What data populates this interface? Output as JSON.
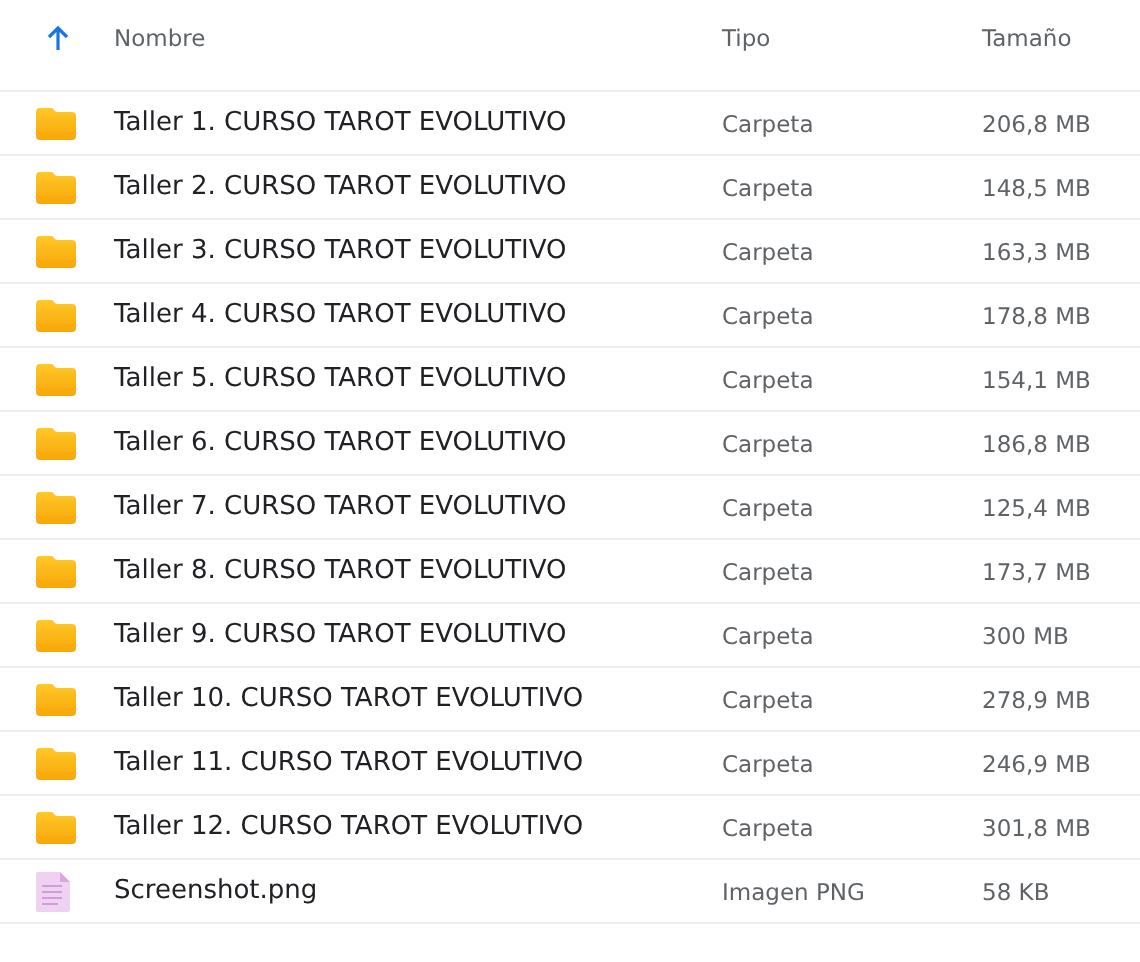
{
  "table": {
    "columns": [
      {
        "label": "Nombre",
        "sorted": true
      },
      {
        "label": "Tipo"
      },
      {
        "label": "Tamaño"
      }
    ],
    "rows": [
      {
        "kind": "folder",
        "name": "Taller 1. CURSO TAROT EVOLUTIVO",
        "type": "Carpeta",
        "size": "206,8 MB"
      },
      {
        "kind": "folder",
        "name": "Taller 2. CURSO TAROT EVOLUTIVO",
        "type": "Carpeta",
        "size": "148,5 MB"
      },
      {
        "kind": "folder",
        "name": "Taller 3. CURSO TAROT EVOLUTIVO",
        "type": "Carpeta",
        "size": "163,3 MB"
      },
      {
        "kind": "folder",
        "name": "Taller 4. CURSO TAROT EVOLUTIVO",
        "type": "Carpeta",
        "size": "178,8 MB"
      },
      {
        "kind": "folder",
        "name": "Taller 5. CURSO TAROT EVOLUTIVO",
        "type": "Carpeta",
        "size": "154,1 MB"
      },
      {
        "kind": "folder",
        "name": "Taller 6. CURSO TAROT EVOLUTIVO",
        "type": "Carpeta",
        "size": "186,8 MB"
      },
      {
        "kind": "folder",
        "name": "Taller 7. CURSO TAROT EVOLUTIVO",
        "type": "Carpeta",
        "size": "125,4 MB"
      },
      {
        "kind": "folder",
        "name": "Taller 8. CURSO TAROT EVOLUTIVO",
        "type": "Carpeta",
        "size": "173,7 MB"
      },
      {
        "kind": "folder",
        "name": "Taller 9. CURSO TAROT EVOLUTIVO",
        "type": "Carpeta",
        "size": "300 MB"
      },
      {
        "kind": "folder",
        "name": "Taller 10. CURSO TAROT EVOLUTIVO",
        "type": "Carpeta",
        "size": "278,9 MB"
      },
      {
        "kind": "folder",
        "name": "Taller 11. CURSO TAROT EVOLUTIVO",
        "type": "Carpeta",
        "size": "246,9 MB"
      },
      {
        "kind": "folder",
        "name": "Taller 12. CURSO TAROT EVOLUTIVO",
        "type": "Carpeta",
        "size": "301,8 MB"
      },
      {
        "kind": "image",
        "name": "Screenshot.png",
        "type": "Imagen PNG",
        "size": "58 KB"
      }
    ]
  }
}
